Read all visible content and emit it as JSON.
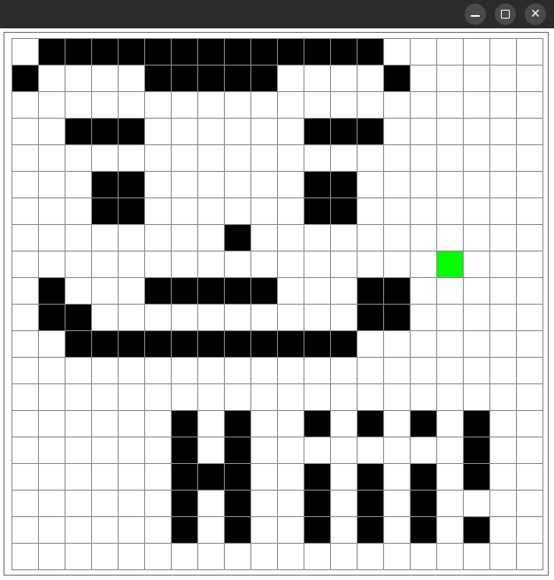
{
  "window": {
    "controls": {
      "minimize": "minimize",
      "maximize": "maximize",
      "close": "✕"
    }
  },
  "colors": {
    "filled": "#000000",
    "empty": "#ffffff",
    "highlight": "#00ff00",
    "gridline": "#8a8a8a"
  },
  "grid": {
    "columns": 20,
    "rows": 20,
    "cells": [
      "01111111111111000000",
      "10000111110000100000",
      "00000000000000000000",
      "00111000000111000000",
      "00000000000000000000",
      "00011000000110000000",
      "00011000000110000000",
      "00000000100000000000",
      "00000000000000002000",
      "01000111110001100000",
      "01100000000001100000",
      "00111111111110000000",
      "00000000000000000000",
      "00000000000000000000",
      "00000010100101010100",
      "00000010100000000100",
      "00000011100101010100",
      "00000010100101010000",
      "00000010100101010100",
      "00000000000000000000"
    ]
  }
}
